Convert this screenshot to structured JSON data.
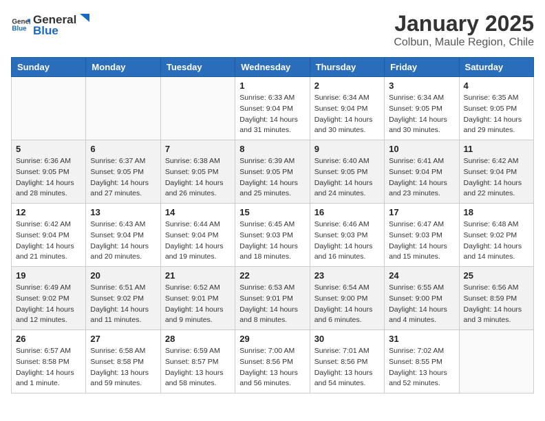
{
  "header": {
    "logo_general": "General",
    "logo_blue": "Blue",
    "title": "January 2025",
    "subtitle": "Colbun, Maule Region, Chile"
  },
  "days_of_week": [
    "Sunday",
    "Monday",
    "Tuesday",
    "Wednesday",
    "Thursday",
    "Friday",
    "Saturday"
  ],
  "weeks": [
    [
      {
        "day": "",
        "info": ""
      },
      {
        "day": "",
        "info": ""
      },
      {
        "day": "",
        "info": ""
      },
      {
        "day": "1",
        "info": "Sunrise: 6:33 AM\nSunset: 9:04 PM\nDaylight: 14 hours and 31 minutes."
      },
      {
        "day": "2",
        "info": "Sunrise: 6:34 AM\nSunset: 9:04 PM\nDaylight: 14 hours and 30 minutes."
      },
      {
        "day": "3",
        "info": "Sunrise: 6:34 AM\nSunset: 9:05 PM\nDaylight: 14 hours and 30 minutes."
      },
      {
        "day": "4",
        "info": "Sunrise: 6:35 AM\nSunset: 9:05 PM\nDaylight: 14 hours and 29 minutes."
      }
    ],
    [
      {
        "day": "5",
        "info": "Sunrise: 6:36 AM\nSunset: 9:05 PM\nDaylight: 14 hours and 28 minutes."
      },
      {
        "day": "6",
        "info": "Sunrise: 6:37 AM\nSunset: 9:05 PM\nDaylight: 14 hours and 27 minutes."
      },
      {
        "day": "7",
        "info": "Sunrise: 6:38 AM\nSunset: 9:05 PM\nDaylight: 14 hours and 26 minutes."
      },
      {
        "day": "8",
        "info": "Sunrise: 6:39 AM\nSunset: 9:05 PM\nDaylight: 14 hours and 25 minutes."
      },
      {
        "day": "9",
        "info": "Sunrise: 6:40 AM\nSunset: 9:05 PM\nDaylight: 14 hours and 24 minutes."
      },
      {
        "day": "10",
        "info": "Sunrise: 6:41 AM\nSunset: 9:04 PM\nDaylight: 14 hours and 23 minutes."
      },
      {
        "day": "11",
        "info": "Sunrise: 6:42 AM\nSunset: 9:04 PM\nDaylight: 14 hours and 22 minutes."
      }
    ],
    [
      {
        "day": "12",
        "info": "Sunrise: 6:42 AM\nSunset: 9:04 PM\nDaylight: 14 hours and 21 minutes."
      },
      {
        "day": "13",
        "info": "Sunrise: 6:43 AM\nSunset: 9:04 PM\nDaylight: 14 hours and 20 minutes."
      },
      {
        "day": "14",
        "info": "Sunrise: 6:44 AM\nSunset: 9:04 PM\nDaylight: 14 hours and 19 minutes."
      },
      {
        "day": "15",
        "info": "Sunrise: 6:45 AM\nSunset: 9:03 PM\nDaylight: 14 hours and 18 minutes."
      },
      {
        "day": "16",
        "info": "Sunrise: 6:46 AM\nSunset: 9:03 PM\nDaylight: 14 hours and 16 minutes."
      },
      {
        "day": "17",
        "info": "Sunrise: 6:47 AM\nSunset: 9:03 PM\nDaylight: 14 hours and 15 minutes."
      },
      {
        "day": "18",
        "info": "Sunrise: 6:48 AM\nSunset: 9:02 PM\nDaylight: 14 hours and 14 minutes."
      }
    ],
    [
      {
        "day": "19",
        "info": "Sunrise: 6:49 AM\nSunset: 9:02 PM\nDaylight: 14 hours and 12 minutes."
      },
      {
        "day": "20",
        "info": "Sunrise: 6:51 AM\nSunset: 9:02 PM\nDaylight: 14 hours and 11 minutes."
      },
      {
        "day": "21",
        "info": "Sunrise: 6:52 AM\nSunset: 9:01 PM\nDaylight: 14 hours and 9 minutes."
      },
      {
        "day": "22",
        "info": "Sunrise: 6:53 AM\nSunset: 9:01 PM\nDaylight: 14 hours and 8 minutes."
      },
      {
        "day": "23",
        "info": "Sunrise: 6:54 AM\nSunset: 9:00 PM\nDaylight: 14 hours and 6 minutes."
      },
      {
        "day": "24",
        "info": "Sunrise: 6:55 AM\nSunset: 9:00 PM\nDaylight: 14 hours and 4 minutes."
      },
      {
        "day": "25",
        "info": "Sunrise: 6:56 AM\nSunset: 8:59 PM\nDaylight: 14 hours and 3 minutes."
      }
    ],
    [
      {
        "day": "26",
        "info": "Sunrise: 6:57 AM\nSunset: 8:58 PM\nDaylight: 14 hours and 1 minute."
      },
      {
        "day": "27",
        "info": "Sunrise: 6:58 AM\nSunset: 8:58 PM\nDaylight: 13 hours and 59 minutes."
      },
      {
        "day": "28",
        "info": "Sunrise: 6:59 AM\nSunset: 8:57 PM\nDaylight: 13 hours and 58 minutes."
      },
      {
        "day": "29",
        "info": "Sunrise: 7:00 AM\nSunset: 8:56 PM\nDaylight: 13 hours and 56 minutes."
      },
      {
        "day": "30",
        "info": "Sunrise: 7:01 AM\nSunset: 8:56 PM\nDaylight: 13 hours and 54 minutes."
      },
      {
        "day": "31",
        "info": "Sunrise: 7:02 AM\nSunset: 8:55 PM\nDaylight: 13 hours and 52 minutes."
      },
      {
        "day": "",
        "info": ""
      }
    ]
  ]
}
